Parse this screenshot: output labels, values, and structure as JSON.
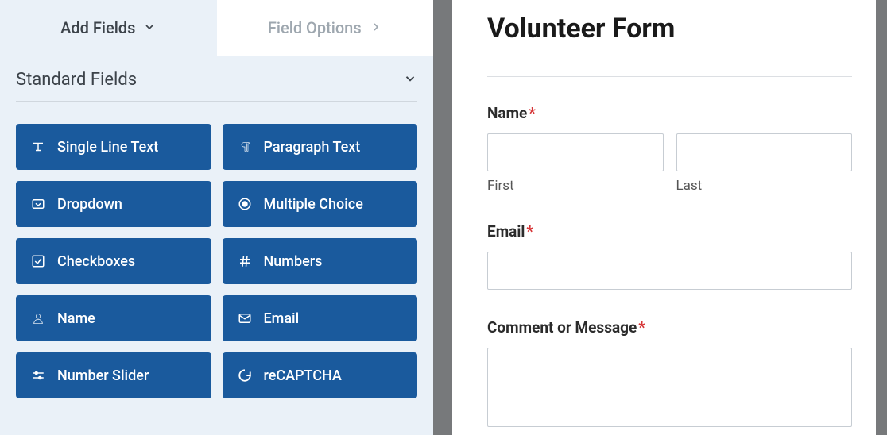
{
  "tabs": {
    "add_fields": "Add Fields",
    "field_options": "Field Options"
  },
  "section": {
    "title": "Standard Fields"
  },
  "fields": {
    "single_line": "Single Line Text",
    "paragraph": "Paragraph Text",
    "dropdown": "Dropdown",
    "multiple_choice": "Multiple Choice",
    "checkboxes": "Checkboxes",
    "numbers": "Numbers",
    "name": "Name",
    "email": "Email",
    "number_slider": "Number Slider",
    "recaptcha": "reCAPTCHA"
  },
  "form": {
    "title": "Volunteer Form",
    "name_label": "Name",
    "first_sub": "First",
    "last_sub": "Last",
    "email_label": "Email",
    "comment_label": "Comment or Message"
  }
}
